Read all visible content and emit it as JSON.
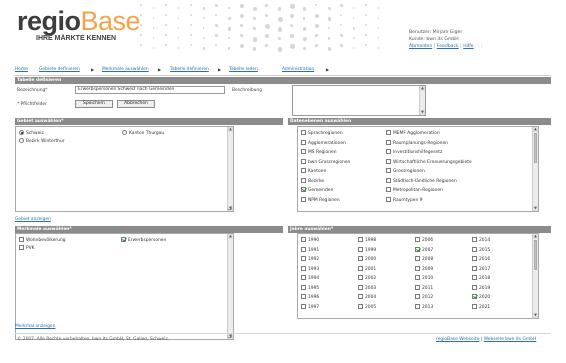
{
  "logo": {
    "part1": "regio",
    "part2": "Base",
    "subtitle": "IHRE MÄRKTE KENNEN"
  },
  "user": {
    "benutzer": "Benutzer: Mirjam Giger",
    "kunde": "Kunde: bwn its GmbH",
    "links": [
      "Abmelden",
      "Feedback",
      "Hilfe"
    ],
    "separator": "|",
    "faded": "| | |"
  },
  "nav": {
    "items": [
      "Home",
      "Gebiete definieren",
      "Merkmale auswählen",
      "Tabelle definieren",
      "Tabelle laden",
      "Administration"
    ],
    "arrow": "▶"
  },
  "table_define": {
    "title": "Tabelle definieren",
    "label_bezeichnung": "Bezeichnung*",
    "bezeichnung_value": "Erwerbspersonen Schweiz nach Gemeinden",
    "label_beschreibung": "Beschreibung",
    "beschreibung_value": "",
    "pflichtfelder": "* Pflichtfelder",
    "speichern": "Speichern",
    "abbrechen": "Abbrechen"
  },
  "gebiet": {
    "title": "Gebiet auswählen*",
    "options": [
      {
        "label": "Schweiz",
        "checked": true
      },
      {
        "label": "Kanton Thurgau",
        "checked": false
      },
      {
        "label": "Bezirk Winterthur",
        "checked": false
      }
    ],
    "link": "Gebiet anzeigen"
  },
  "datenebenen": {
    "title": "Datenebenen auswählen",
    "col1": [
      {
        "label": "Sprachregionen",
        "checked": false
      },
      {
        "label": "Agglomerationen",
        "checked": false
      },
      {
        "label": "MS Regionen",
        "checked": false
      },
      {
        "label": "bwn Grossregionen",
        "checked": false
      },
      {
        "label": "Kantone",
        "checked": false
      },
      {
        "label": "Bezirke",
        "checked": false
      },
      {
        "label": "Gemeinden",
        "checked": true
      },
      {
        "label": "NPM Regionen",
        "checked": false
      }
    ],
    "col2": [
      {
        "label": "MEMF Agglomeration",
        "checked": false
      },
      {
        "label": "Raumplanungs-Regionen",
        "checked": false
      },
      {
        "label": "Investitionshilfegesetz",
        "checked": false
      },
      {
        "label": "Wirtschaftliche Erneuerungsgebiete",
        "checked": false
      },
      {
        "label": "Grossregionen",
        "checked": false
      },
      {
        "label": "Städtisch-ländliche Regionen",
        "checked": false
      },
      {
        "label": "Metropolitan-Regionen",
        "checked": false
      },
      {
        "label": "Raumtypen 9",
        "checked": false
      }
    ]
  },
  "merkmale": {
    "title": "Merkmale auswählen*",
    "options": [
      {
        "label": "Wohnbevölkerung",
        "checked": false
      },
      {
        "label": "Erwerbspersonen",
        "checked": true
      },
      {
        "label": "PVK",
        "checked": false
      }
    ],
    "link": "Merkmal anzeigen"
  },
  "jahre": {
    "title": "Jahre auswählen*",
    "columns": [
      [
        {
          "label": "1990",
          "checked": false
        },
        {
          "label": "1991",
          "checked": false
        },
        {
          "label": "1992",
          "checked": false
        },
        {
          "label": "1993",
          "checked": false
        },
        {
          "label": "1994",
          "checked": false
        },
        {
          "label": "1995",
          "checked": false
        },
        {
          "label": "1996",
          "checked": false
        },
        {
          "label": "1997",
          "checked": false
        }
      ],
      [
        {
          "label": "1998",
          "checked": false
        },
        {
          "label": "1999",
          "checked": false
        },
        {
          "label": "2000",
          "checked": false
        },
        {
          "label": "2001",
          "checked": false
        },
        {
          "label": "2002",
          "checked": false
        },
        {
          "label": "2003",
          "checked": false
        },
        {
          "label": "2004",
          "checked": false
        },
        {
          "label": "2005",
          "checked": false
        }
      ],
      [
        {
          "label": "2006",
          "checked": false
        },
        {
          "label": "2007",
          "checked": true
        },
        {
          "label": "2008",
          "checked": false
        },
        {
          "label": "2009",
          "checked": false
        },
        {
          "label": "2010",
          "checked": false
        },
        {
          "label": "2011",
          "checked": false
        },
        {
          "label": "2012",
          "checked": false
        },
        {
          "label": "2013",
          "checked": false
        }
      ],
      [
        {
          "label": "2014",
          "checked": false
        },
        {
          "label": "2015",
          "checked": false
        },
        {
          "label": "2016",
          "checked": false
        },
        {
          "label": "2017",
          "checked": false
        },
        {
          "label": "2018",
          "checked": false
        },
        {
          "label": "2019",
          "checked": false
        },
        {
          "label": "2020",
          "checked": true
        },
        {
          "label": "2021",
          "checked": false
        }
      ]
    ]
  },
  "footer": {
    "copyright": "© 2007. Alle Rechte vorbehalten. bwn its GmbH, St. Gallen, Schweiz.",
    "link1": "regioBase Webseite",
    "sep": "|",
    "link2": "Webseite bwn its GmbH"
  }
}
